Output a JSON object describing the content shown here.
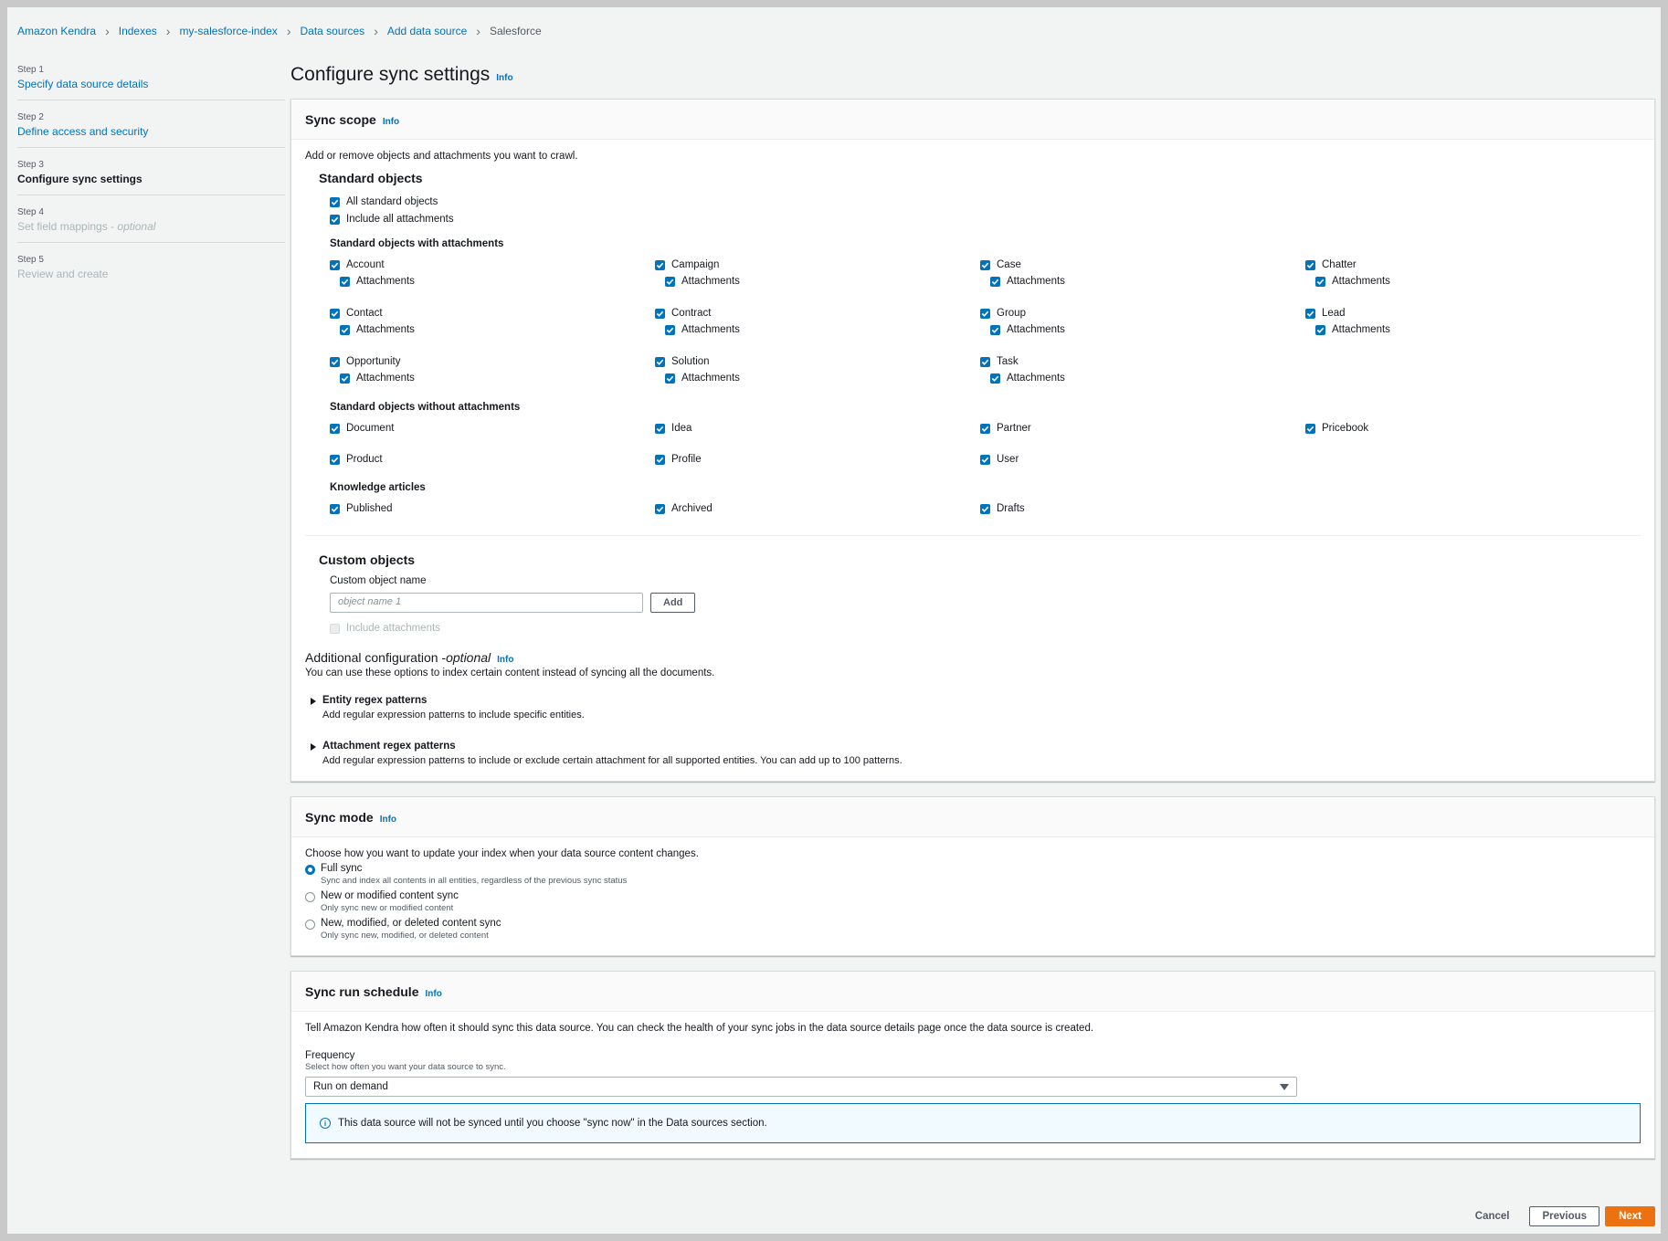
{
  "breadcrumb": {
    "items": [
      "Amazon Kendra",
      "Indexes",
      "my-salesforce-index",
      "Data sources",
      "Add data source"
    ],
    "current": "Salesforce"
  },
  "steps": [
    {
      "num": "Step 1",
      "label": "Specify data source details",
      "state": "link"
    },
    {
      "num": "Step 2",
      "label": "Define access and security",
      "state": "link"
    },
    {
      "num": "Step 3",
      "label": "Configure sync settings",
      "state": "active"
    },
    {
      "num": "Step 4",
      "label": "Set field mappings - ",
      "optional": "optional",
      "state": "disabled"
    },
    {
      "num": "Step 5",
      "label": "Review and create",
      "state": "disabled"
    }
  ],
  "page_title": "Configure sync settings",
  "info": "Info",
  "sync_scope": {
    "title": "Sync scope",
    "description": "Add or remove objects and attachments you want to crawl.",
    "standard_heading": "Standard objects",
    "all_standard": "All standard objects",
    "include_all_attachments": "Include all attachments",
    "with_attachments_heading": "Standard objects with attachments",
    "attachments_label": "Attachments",
    "with_attachments": [
      "Account",
      "Campaign",
      "Case",
      "Chatter",
      "Contact",
      "Contract",
      "Group",
      "Lead",
      "Opportunity",
      "Solution",
      "Task"
    ],
    "without_attachments_heading": "Standard objects without attachments",
    "without_attachments": [
      "Document",
      "Idea",
      "Partner",
      "Pricebook",
      "Product",
      "Profile",
      "User"
    ],
    "knowledge_heading": "Knowledge articles",
    "knowledge": [
      "Published",
      "Archived",
      "Drafts"
    ],
    "custom_heading": "Custom objects",
    "custom_field_label": "Custom object name",
    "custom_placeholder": "object name 1",
    "add_button": "Add",
    "custom_include_attachments": "Include attachments",
    "additional_title": "Additional configuration - ",
    "additional_optional": "optional",
    "additional_desc": "You can use these options to index certain content instead of syncing all the documents.",
    "entity_title": "Entity regex patterns",
    "entity_desc": "Add regular expression patterns to include specific entities.",
    "attachment_title": "Attachment regex patterns",
    "attachment_desc": "Add regular expression patterns to include or exclude certain attachment for all supported entities. You can add up to 100 patterns."
  },
  "sync_mode": {
    "title": "Sync mode",
    "description": "Choose how you want to update your index when your data source content changes.",
    "options": [
      {
        "label": "Full sync",
        "sub": "Sync and index all contents in all entities, regardless of the previous sync status",
        "selected": true
      },
      {
        "label": "New or modified content sync",
        "sub": "Only sync new or modified content",
        "selected": false
      },
      {
        "label": "New, modified, or deleted content sync",
        "sub": "Only sync new, modified, or deleted content",
        "selected": false
      }
    ]
  },
  "schedule": {
    "title": "Sync run schedule",
    "description": "Tell Amazon Kendra how often it should sync this data source. You can check the health of your sync jobs in the data source details page once the data source is created.",
    "frequency_label": "Frequency",
    "frequency_sub": "Select how often you want your data source to sync.",
    "frequency_value": "Run on demand",
    "alert": "This data source will not be synced until you choose \"sync now\" in the Data sources section."
  },
  "footer": {
    "cancel": "Cancel",
    "previous": "Previous",
    "next": "Next"
  },
  "colors": {
    "accent": "#0073bb",
    "primary_button": "#ec7211"
  }
}
